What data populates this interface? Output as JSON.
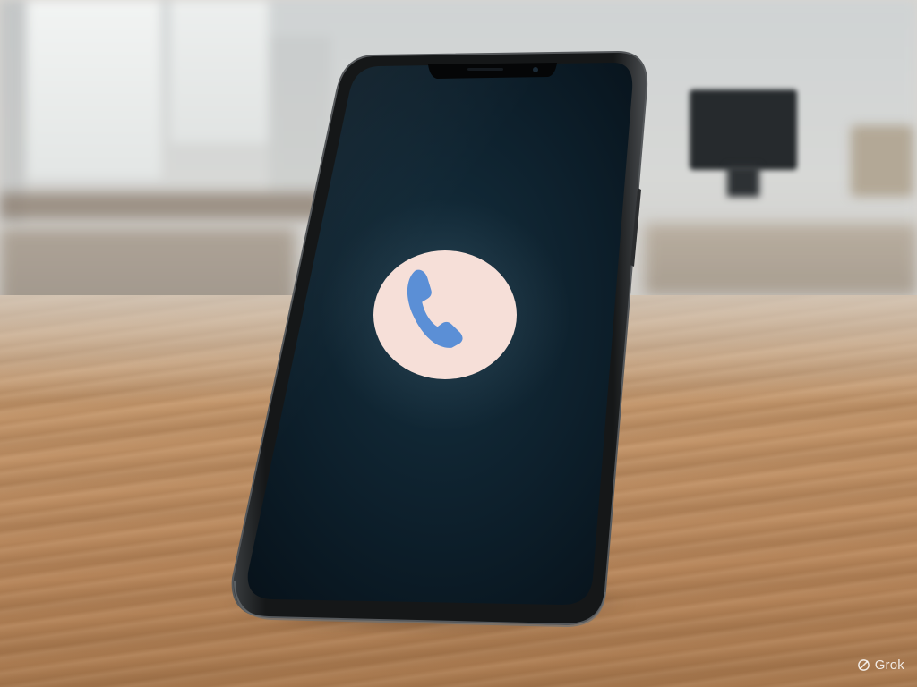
{
  "scene": {
    "subject": "smartphone",
    "screen_icon": "phone-handset-icon"
  },
  "watermark": {
    "text": "Grok",
    "icon": "grok-logo-icon"
  },
  "colors": {
    "screen": "#0e1c26",
    "icon_circle": "#f6dfd8",
    "handset": "#5b8fd6",
    "phone_frame": "#1d1f21",
    "table": "#c29469"
  }
}
